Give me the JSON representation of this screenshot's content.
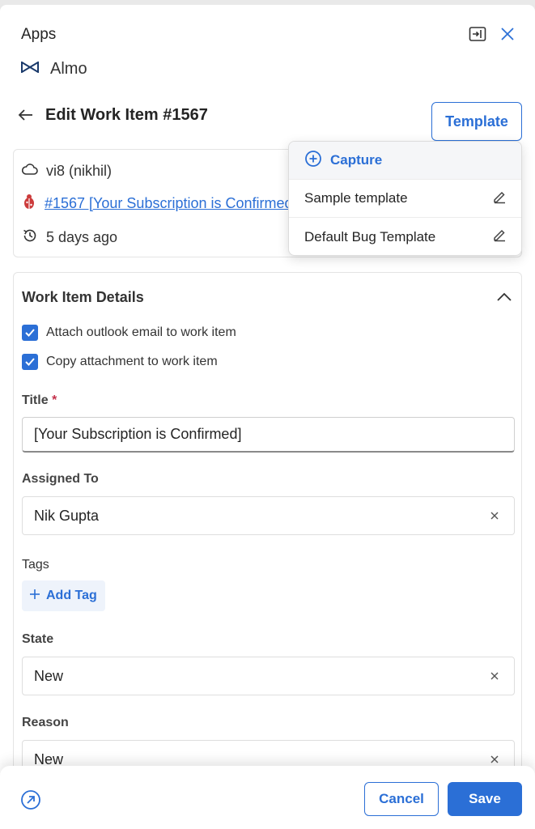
{
  "header": {
    "title": "Apps",
    "popout_icon": "pop-out-icon",
    "close_icon": "close-icon",
    "app_name": "Almo",
    "app_logo": "almo-logo-icon"
  },
  "nav": {
    "back_icon": "arrow-left-icon",
    "title": "Edit Work Item #1567",
    "template_label": "Template"
  },
  "info": {
    "project": "vi8 (nikhil)",
    "link": "#1567 [Your Subscription is Confirmed]",
    "time": "5 days ago"
  },
  "template_menu": {
    "capture_label": "Capture",
    "items": [
      {
        "label": "Sample template"
      },
      {
        "label": "Default Bug Template"
      }
    ]
  },
  "details": {
    "section_title": "Work Item Details",
    "checkbox_1": "Attach outlook email to work item",
    "checkbox_2": "Copy attachment to work item",
    "title_label": "Title",
    "title_required": "*",
    "title_value": "[Your Subscription is Confirmed]",
    "assigned_label": "Assigned To",
    "assigned_value": "Nik Gupta",
    "tags_label": "Tags",
    "add_tag_label": "Add Tag",
    "state_label": "State",
    "state_value": "New",
    "reason_label": "Reason",
    "reason_value": "New"
  },
  "footer": {
    "cancel_label": "Cancel",
    "save_label": "Save"
  },
  "colors": {
    "accent": "#2b6fd6",
    "required": "#c4314b"
  }
}
